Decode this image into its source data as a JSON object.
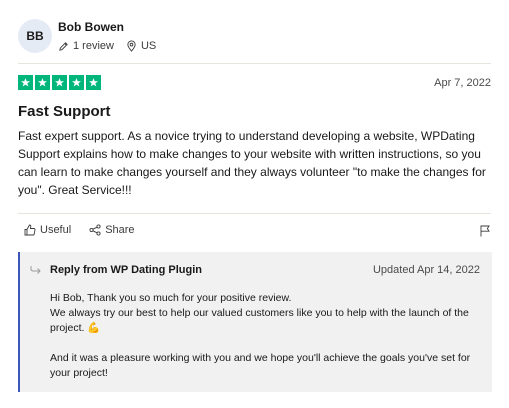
{
  "reviewer": {
    "initials": "BB",
    "name": "Bob Bowen",
    "review_count": "1 review",
    "country": "US",
    "avatar_color": "#e5ebf5"
  },
  "review": {
    "rating": 5,
    "max_rating": 5,
    "star_color": "#00b67a",
    "date": "Apr 7, 2022",
    "title": "Fast Support",
    "body": "Fast expert support. As a novice trying to understand developing a website, WPDating Support explains how to make changes to your website with written instructions, so you can learn to make changes yourself and they always volunteer \"to make the changes for you\". Great Service!!!"
  },
  "actions": {
    "useful_label": "Useful",
    "share_label": "Share",
    "useful_icon": "thumbs-up-icon",
    "share_icon": "share-icon",
    "flag_icon": "flag-icon"
  },
  "reply": {
    "title": "Reply from WP Dating Plugin",
    "date": "Updated Apr 14, 2022",
    "accent_color": "#3c57bc",
    "paragraph_1": "Hi Bob, Thank you so much for your positive review.\nWe always try our best to help our valued customers like you to help with the launch of the project. 💪",
    "paragraph_2": "And it was a pleasure working with you and we hope you'll achieve the goals you've set for your project!"
  }
}
